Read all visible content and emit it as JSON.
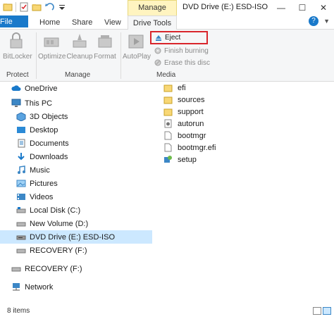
{
  "titlebar": {
    "context_tab": "Manage",
    "window_title": "DVD Drive (E:) ESD-ISO",
    "minimize": "—",
    "maximize": "☐",
    "close": "✕"
  },
  "tabs": {
    "file": "File",
    "home": "Home",
    "share": "Share",
    "view": "View",
    "drive_tools": "Drive Tools"
  },
  "ribbon": {
    "protect": {
      "bitlocker": "BitLocker",
      "label": "Protect"
    },
    "manage": {
      "optimize": "Optimize",
      "cleanup": "Cleanup",
      "format": "Format",
      "label": "Manage"
    },
    "media": {
      "autoplay": "AutoPlay",
      "eject": "Eject",
      "finish_burning": "Finish burning",
      "erase": "Erase this disc",
      "label": "Media"
    }
  },
  "nav": [
    {
      "label": "OneDrive",
      "icon": "cloud-icon"
    },
    {
      "label": "This PC",
      "icon": "computer-icon"
    },
    {
      "label": "3D Objects",
      "icon": "cube-icon"
    },
    {
      "label": "Desktop",
      "icon": "desktop-icon"
    },
    {
      "label": "Documents",
      "icon": "documents-icon"
    },
    {
      "label": "Downloads",
      "icon": "download-icon"
    },
    {
      "label": "Music",
      "icon": "music-icon"
    },
    {
      "label": "Pictures",
      "icon": "pictures-icon"
    },
    {
      "label": "Videos",
      "icon": "videos-icon"
    },
    {
      "label": "Local Disk (C:)",
      "icon": "disk-icon"
    },
    {
      "label": "New Volume (D:)",
      "icon": "drive-icon"
    },
    {
      "label": "DVD Drive (E:) ESD-ISO",
      "icon": "dvd-icon",
      "selected": true
    },
    {
      "label": "RECOVERY (F:)",
      "icon": "drive-icon"
    },
    {
      "label": "RECOVERY (F:)",
      "icon": "drive-icon"
    },
    {
      "label": "Network",
      "icon": "network-icon"
    }
  ],
  "files": [
    {
      "name": "efi",
      "icon": "folder-icon"
    },
    {
      "name": "sources",
      "icon": "folder-icon"
    },
    {
      "name": "support",
      "icon": "folder-icon"
    },
    {
      "name": "autorun",
      "icon": "settings-file-icon"
    },
    {
      "name": "bootmgr",
      "icon": "file-icon"
    },
    {
      "name": "bootmgr.efi",
      "icon": "file-icon"
    },
    {
      "name": "setup",
      "icon": "setup-icon"
    }
  ],
  "status": {
    "item_count": "8 items"
  },
  "colors": {
    "accent": "#1979ca",
    "selection": "#cce8ff",
    "highlight_border": "#d9262c",
    "context_tab": "#fff4c0"
  }
}
